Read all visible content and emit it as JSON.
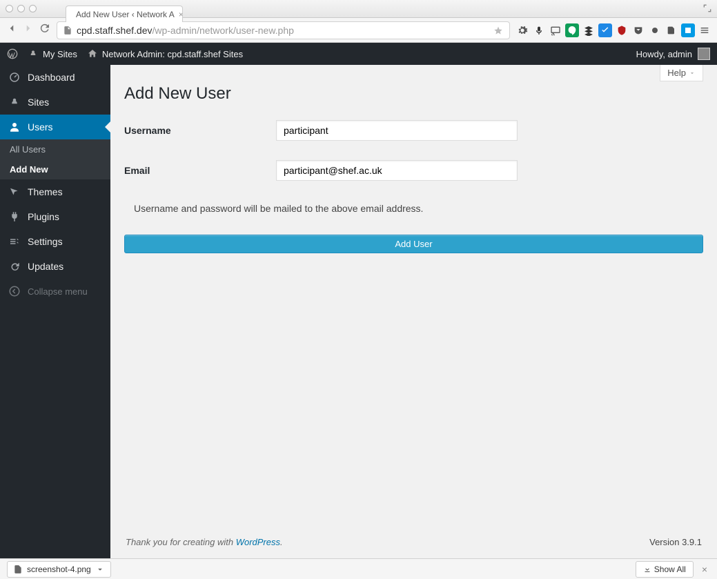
{
  "browser": {
    "tab_title": "Add New User ‹ Network A",
    "url_host": "cpd.staff.shef.dev",
    "url_path": "/wp-admin/network/user-new.php"
  },
  "adminbar": {
    "my_sites": "My Sites",
    "network_admin": "Network Admin: cpd.staff.shef Sites",
    "howdy": "Howdy, admin"
  },
  "sidebar": {
    "items": [
      {
        "label": "Dashboard"
      },
      {
        "label": "Sites"
      },
      {
        "label": "Users"
      },
      {
        "label": "Themes"
      },
      {
        "label": "Plugins"
      },
      {
        "label": "Settings"
      },
      {
        "label": "Updates"
      }
    ],
    "submenu": {
      "all_users": "All Users",
      "add_new": "Add New"
    },
    "collapse": "Collapse menu"
  },
  "page": {
    "help_label": "Help",
    "title": "Add New User",
    "username_label": "Username",
    "username_value": "participant",
    "email_label": "Email",
    "email_value": "participant@shef.ac.uk",
    "note": "Username and password will be mailed to the above email address.",
    "submit_label": "Add User"
  },
  "footer": {
    "thanks": "Thank you for creating with ",
    "wp": "WordPress",
    "version": "Version 3.9.1"
  },
  "shelf": {
    "file": "screenshot-4.png",
    "show_all": "Show All"
  }
}
